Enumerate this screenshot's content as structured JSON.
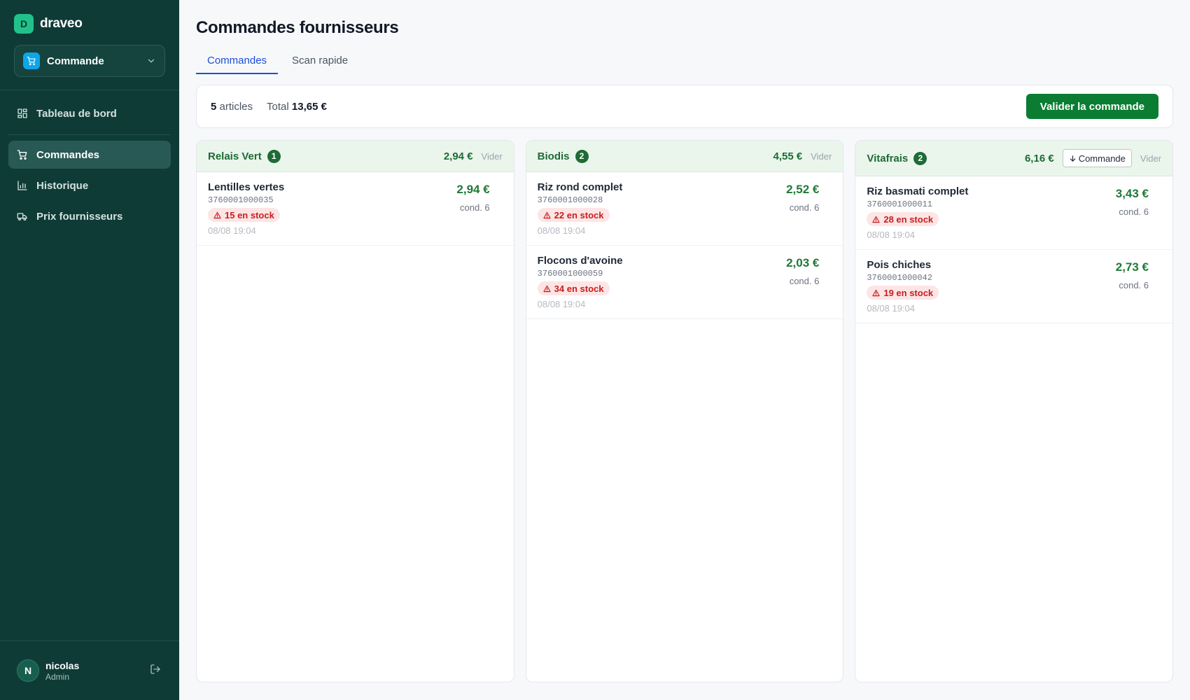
{
  "brand": {
    "logo_letter": "D",
    "name": "draveo"
  },
  "module_select": {
    "label": "Commande"
  },
  "nav": {
    "dashboard": "Tableau de bord",
    "orders": "Commandes",
    "history": "Historique",
    "supplier_prices": "Prix fournisseurs"
  },
  "user": {
    "initial": "N",
    "name": "nicolas",
    "role": "Admin"
  },
  "page": {
    "title": "Commandes fournisseurs"
  },
  "tabs": {
    "orders": "Commandes",
    "quick_scan": "Scan rapide"
  },
  "summary": {
    "count": "5",
    "count_label": "articles",
    "total_label": "Total",
    "total_value": "13,65 €",
    "validate_label": "Valider la commande"
  },
  "suppliers": [
    {
      "name": "Relais Vert",
      "count": "1",
      "total": "2,94 €",
      "clear_label": "Vider",
      "items": [
        {
          "name": "Lentilles vertes",
          "ean": "3760001000035",
          "stock": "15 en stock",
          "date": "08/08 19:04",
          "price": "2,94 €",
          "cond": "cond. 6"
        }
      ]
    },
    {
      "name": "Biodis",
      "count": "2",
      "total": "4,55 €",
      "clear_label": "Vider",
      "items": [
        {
          "name": "Riz rond complet",
          "ean": "3760001000028",
          "stock": "22 en stock",
          "date": "08/08 19:04",
          "price": "2,52 €",
          "cond": "cond. 6"
        },
        {
          "name": "Flocons d'avoine",
          "ean": "3760001000059",
          "stock": "34 en stock",
          "date": "08/08 19:04",
          "price": "2,03 €",
          "cond": "cond. 6"
        }
      ]
    },
    {
      "name": "Vitafrais",
      "count": "2",
      "total": "6,16 €",
      "order_label": "Commande",
      "clear_label": "Vider",
      "items": [
        {
          "name": "Riz basmati complet",
          "ean": "3760001000011",
          "stock": "28 en stock",
          "date": "08/08 19:04",
          "price": "3,43 €",
          "cond": "cond. 6"
        },
        {
          "name": "Pois chiches",
          "ean": "3760001000042",
          "stock": "19 en stock",
          "date": "08/08 19:04",
          "price": "2,73 €",
          "cond": "cond. 6"
        }
      ]
    }
  ],
  "colors": {
    "sidebar": "#0f3b37",
    "accent": "#0a7d33",
    "tab_active": "#1d4ed8",
    "stock_alert": "#c81e1e"
  }
}
